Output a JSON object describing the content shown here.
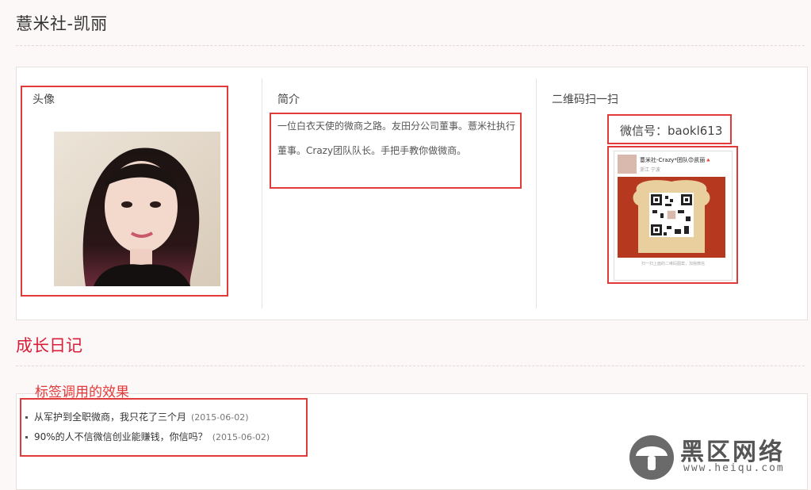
{
  "page": {
    "title": "薏米社-凯丽"
  },
  "profile": {
    "avatar_label": "头像",
    "intro_label": "简介",
    "intro_text": "一位白衣天使的微商之路。友田分公司董事。薏米社执行董事。Crazy团队队长。手把手教你做微商。",
    "qr_label": "二维码扫一扫",
    "wechat_label": "微信号：baokl613",
    "qr_card": {
      "name": "薏米社-Crazy*团队😊凯丽🔺",
      "location": "浙江 宁波",
      "caption": "扫一扫上面的二维码图案，加我微信"
    }
  },
  "diary": {
    "section_title": "成长日记",
    "tag_note": "标签调用的效果",
    "items": [
      {
        "title": "从军护到全职微商，我只花了三个月",
        "date": "(2015-06-02)"
      },
      {
        "title": "90%的人不信微信创业能赚钱，你信吗？",
        "date": "(2015-06-02)"
      }
    ]
  },
  "watermark": {
    "text": "黑区网络",
    "url": "www.heiqu.com"
  },
  "colors": {
    "accent_red": "#d81e3a",
    "frame_red": "#e03a3a"
  }
}
